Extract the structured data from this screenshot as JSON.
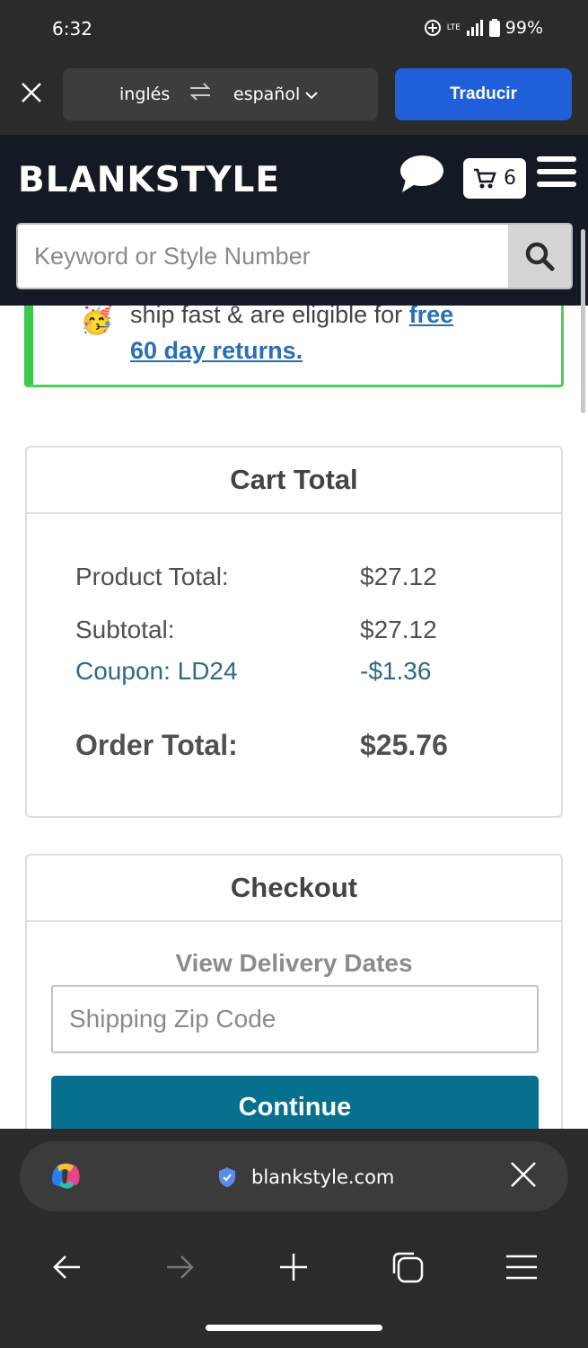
{
  "status": {
    "time": "6:32",
    "network": "LTE",
    "battery": "99%"
  },
  "translate": {
    "from_lang": "inglés",
    "to_lang": "español",
    "translate_button": "Traducir"
  },
  "header": {
    "logo": "BLANKSTYLE",
    "cart_count": "6",
    "search_placeholder": "Keyword or Style Number"
  },
  "promo": {
    "line1_text": "ship fast & are eligible for ",
    "line1_link": "free",
    "line2_link": "60 day returns."
  },
  "cart_total": {
    "title": "Cart Total",
    "product_total_label": "Product Total:",
    "product_total_value": "$27.12",
    "subtotal_label": "Subtotal:",
    "subtotal_value": "$27.12",
    "coupon_label": "Coupon: LD24",
    "coupon_value": "-$1.36",
    "order_total_label": "Order Total:",
    "order_total_value": "$25.76"
  },
  "checkout": {
    "title": "Checkout",
    "delivery_heading": "View Delivery Dates",
    "zip_placeholder": "Shipping Zip Code",
    "continue_label": "Continue"
  },
  "browser": {
    "url": "blankstyle.com"
  },
  "colors": {
    "accent_blue": "#1f5fd9",
    "header_bg": "#141a24",
    "continue_btn": "#06708f",
    "promo_border": "#4cd158",
    "link": "#2a6fb5"
  }
}
